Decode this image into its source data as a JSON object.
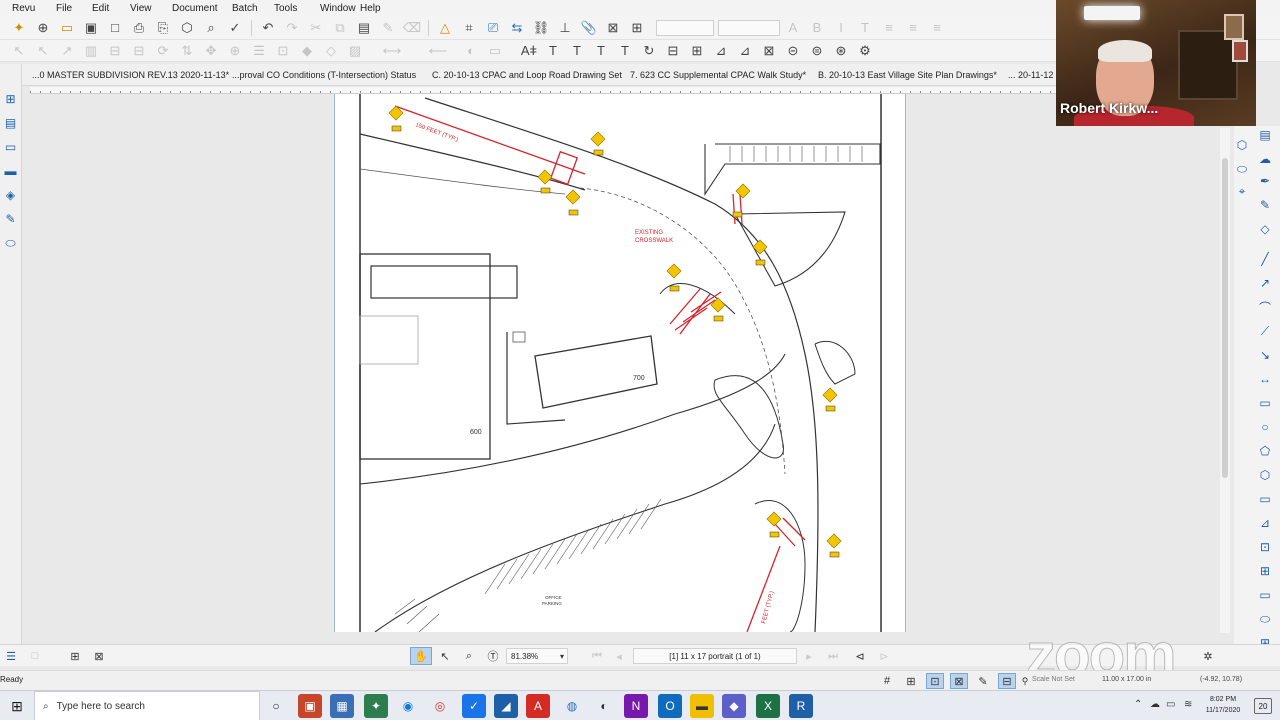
{
  "menu": [
    "Revu",
    "File",
    "Edit",
    "View",
    "Document",
    "Batch",
    "Tools",
    "Window",
    "Help"
  ],
  "tabs": [
    "...0 MASTER SUBDIVISION REV.13 2020-11-13*",
    "...proval CO Conditions (T-Intersection) Status",
    "C. 20-10-13 CPAC and Loop Road Drawing Set",
    "7. 623 CC Supplemental CPAC Walk Study*",
    "B. 20-10-13 East Village Site Plan Drawings*",
    "... 20-11-12 S"
  ],
  "drawing": {
    "labels": {
      "dim_top": "150 FEET (TYP.)",
      "crosswalk": [
        "EXISTING",
        "CROSSWALK"
      ],
      "building_700": "700",
      "building_600": "600",
      "office": [
        "OFFICE",
        "PARKING"
      ],
      "dim_bottom": "FEET (TYP.)"
    }
  },
  "video": {
    "participant_name": "Robert Kirkw..."
  },
  "navigation": {
    "zoom_value": "81.38%",
    "page_info": "[1] 11 x 17 portrait (1 of 1)"
  },
  "watermark": "zoom",
  "status": {
    "ready": "Ready",
    "scale": "Scale Not Set",
    "page_size": "11.00 x 17.00 in",
    "coordinates": "(-4.92, 10.78)"
  },
  "taskbar": {
    "search_placeholder": "Type here to search",
    "time": "8:02 PM",
    "date": "11/17/2020",
    "notifications": "20"
  },
  "colors": {
    "accent_blue": "#1f5fa8",
    "markup_red": "#d8232a",
    "sign_yellow": "#f2c500"
  }
}
